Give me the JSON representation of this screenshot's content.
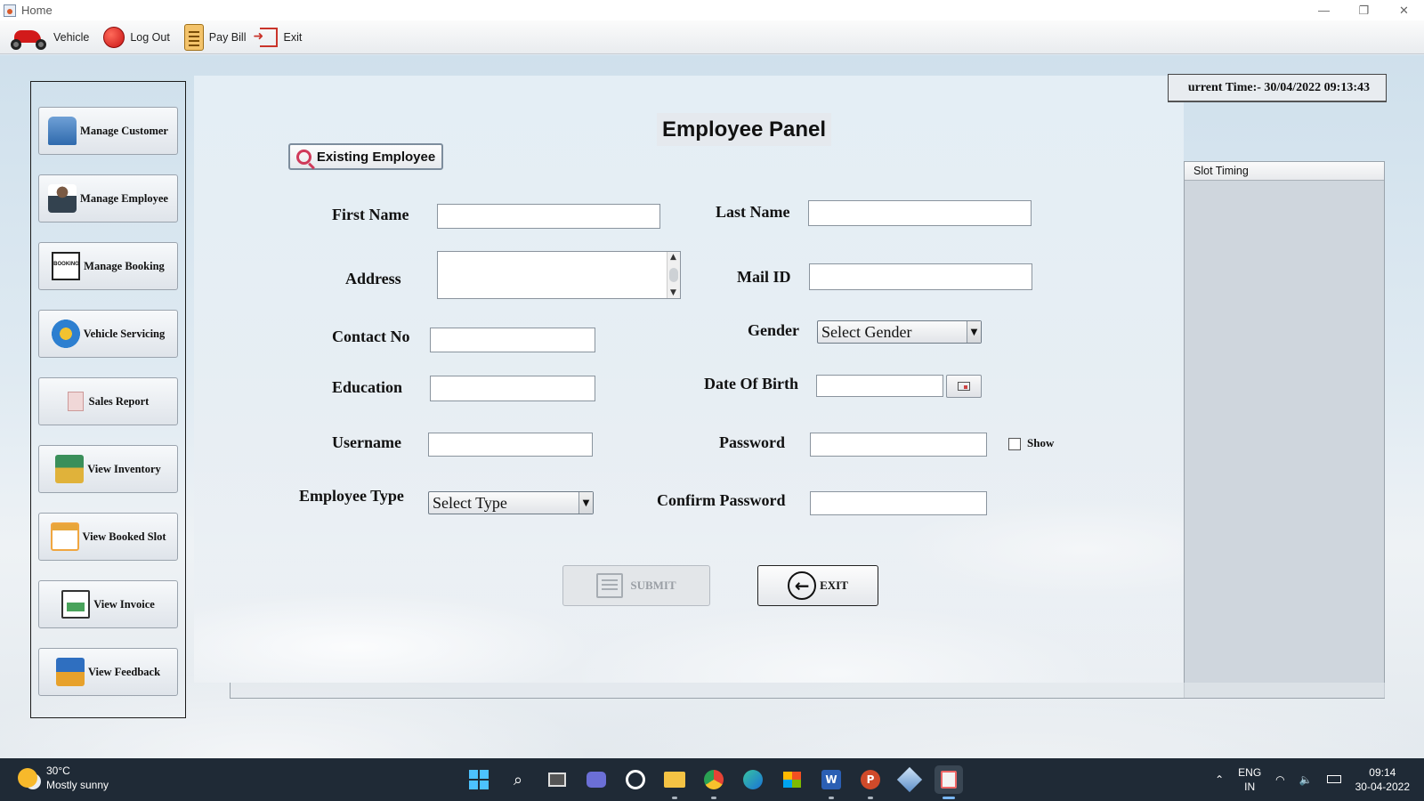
{
  "window": {
    "title": "Home",
    "controls": [
      "—",
      "❐",
      "✕"
    ]
  },
  "toolbar": {
    "items": [
      {
        "label": "Vehicle",
        "icon": "scooter-icon"
      },
      {
        "label": "Log Out",
        "icon": "logout-icon"
      },
      {
        "label": "Pay Bill",
        "icon": "bill-icon"
      },
      {
        "label": "Exit",
        "icon": "exit-icon"
      }
    ]
  },
  "sidebar": {
    "items": [
      {
        "label": "Manage Customer",
        "icon": "customer-icon"
      },
      {
        "label": "Manage Employee",
        "icon": "employee-icon"
      },
      {
        "label": "Manage Booking",
        "icon": "booking-icon"
      },
      {
        "label": "Vehicle Servicing",
        "icon": "service-gear-icon"
      },
      {
        "label": "Sales Report",
        "icon": "sales-report-icon"
      },
      {
        "label": "View Inventory",
        "icon": "inventory-icon"
      },
      {
        "label": "View Booked Slot",
        "icon": "calendar-icon"
      },
      {
        "label": "View Invoice",
        "icon": "invoice-icon"
      },
      {
        "label": "View Feedback",
        "icon": "feedback-icon"
      }
    ]
  },
  "panel": {
    "title": "Employee Panel",
    "existing_button": "Existing Employee",
    "labels": {
      "first_name": "First Name",
      "last_name": "Last Name",
      "address": "Address",
      "mail_id": "Mail ID",
      "contact_no": "Contact No",
      "gender": "Gender",
      "education": "Education",
      "date_of_birth": "Date Of Birth",
      "username": "Username",
      "password": "Password",
      "employee_type": "Employee Type",
      "confirm_password": "Confirm Password",
      "show": "Show"
    },
    "values": {
      "first_name": "",
      "last_name": "",
      "address": "",
      "mail_id": "",
      "contact_no": "",
      "education": "",
      "date_of_birth": "",
      "username": "",
      "password": "",
      "confirm_password": ""
    },
    "gender_select": "Select Gender",
    "employee_type_select": "Select Type",
    "show_password_checked": false,
    "submit_label": "SUBMIT",
    "submit_icon_text": "SUBMIT",
    "exit_label": "EXIT"
  },
  "right": {
    "current_time": "urrent Time:- 30/04/2022 09:13:43",
    "slot_header": "Slot Timing"
  },
  "taskbar": {
    "weather_temp": "30°C",
    "weather_desc": "Mostly sunny",
    "lang_1": "ENG",
    "lang_2": "IN",
    "time": "09:14",
    "date": "30-04-2022"
  }
}
